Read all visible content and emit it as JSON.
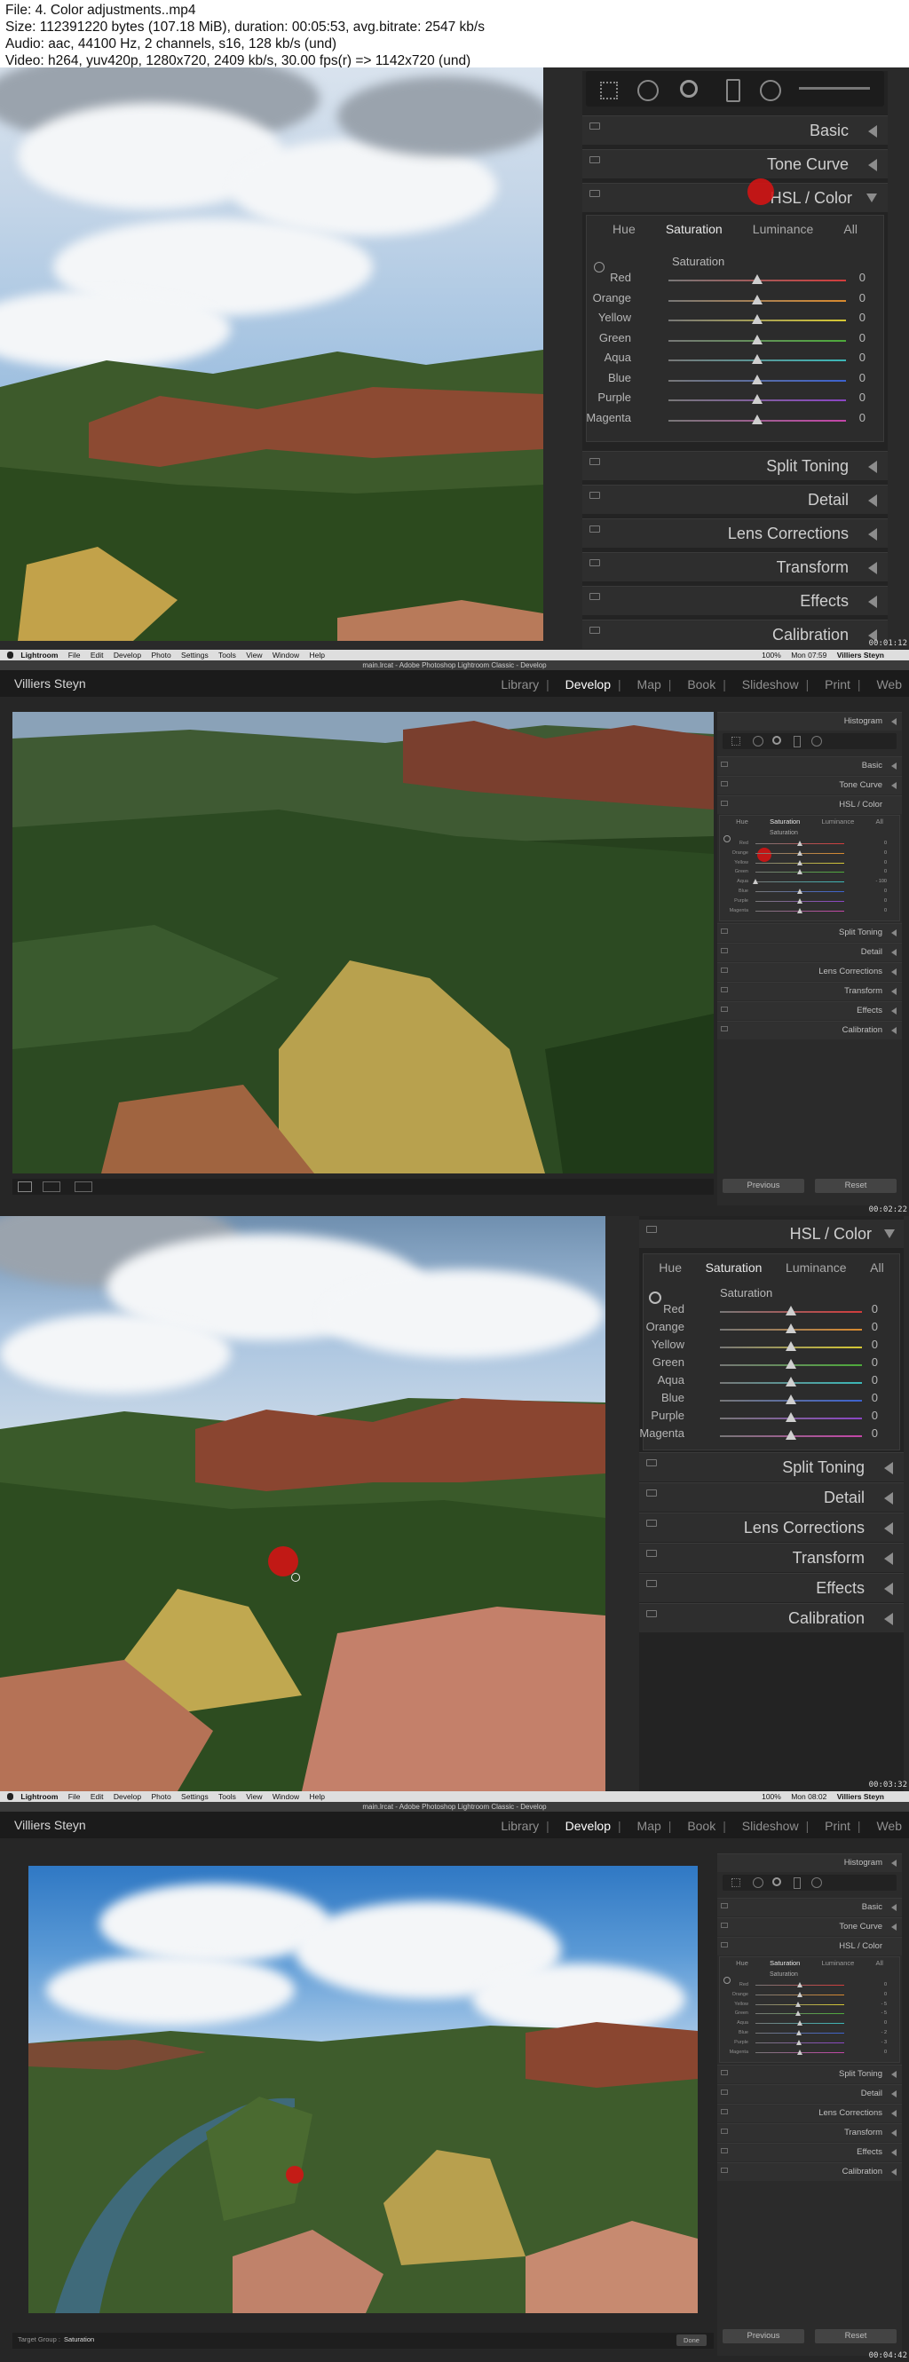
{
  "file_info": {
    "line1": "File: 4. Color adjustments..mp4",
    "line2": "Size: 112391220 bytes (107.18 MiB), duration: 00:05:53, avg.bitrate: 2547 kb/s",
    "line3": "Audio: aac, 44100 Hz, 2 channels, s16, 128 kb/s (und)",
    "line4": "Video: h264, yuv420p, 1280x720, 2409 kb/s, 30.00 fps(r) => 1142x720 (und)"
  },
  "timestamps": [
    "00:01:12",
    "00:02:22",
    "00:03:32",
    "00:04:42"
  ],
  "menubar": {
    "apple": "",
    "items": [
      "Lightroom",
      "File",
      "Edit",
      "Develop",
      "Photo",
      "Settings",
      "Tools",
      "View",
      "Window",
      "Help"
    ],
    "battery": "100%",
    "clock_1": "Mon 07:59",
    "clock_2": "Mon 08:02",
    "user": "Villiers Steyn"
  },
  "window_title": "main.lrcat - Adobe Photoshop Lightroom Classic - Develop",
  "identity": {
    "name": "Villiers Steyn",
    "modules": [
      "Library",
      "Develop",
      "Map",
      "Book",
      "Slideshow",
      "Print",
      "Web"
    ],
    "active_module": "Develop"
  },
  "panels": {
    "histogram": "Histogram",
    "basic": "Basic",
    "tone_curve": "Tone Curve",
    "hsl": "HSL",
    "color": "Color",
    "hsl_color": "HSL / Color",
    "split_toning": "Split Toning",
    "detail": "Detail",
    "lens_corrections": "Lens Corrections",
    "transform": "Transform",
    "effects": "Effects",
    "calibration": "Calibration"
  },
  "hsl_tabs": [
    "Hue",
    "Saturation",
    "Luminance",
    "All"
  ],
  "active_tab": "Saturation",
  "section_label": "Saturation",
  "colors": [
    "Red",
    "Orange",
    "Yellow",
    "Green",
    "Aqua",
    "Blue",
    "Purple",
    "Magenta"
  ],
  "frame1_values": [
    "0",
    "0",
    "0",
    "0",
    "0",
    "0",
    "0",
    "0"
  ],
  "frame2_values": [
    "0",
    "0",
    "0",
    "0",
    "- 100",
    "0",
    "0",
    "0"
  ],
  "frame3_values": [
    "0",
    "0",
    "0",
    "0",
    "0",
    "0",
    "0",
    "0"
  ],
  "frame4_values": [
    "0",
    "0",
    "- 5",
    "- 5",
    "0",
    "- 2",
    "- 3",
    "0"
  ],
  "buttons": {
    "previous": "Previous",
    "reset": "Reset",
    "done": "Done"
  },
  "target_group": {
    "label": "Target Group :",
    "value": "Saturation"
  },
  "track_colors": [
    "#d23c3c",
    "#d98a2e",
    "#d6c833",
    "#4dab3a",
    "#3bb8b8",
    "#3c62cf",
    "#8a45c4",
    "#c445a8"
  ]
}
